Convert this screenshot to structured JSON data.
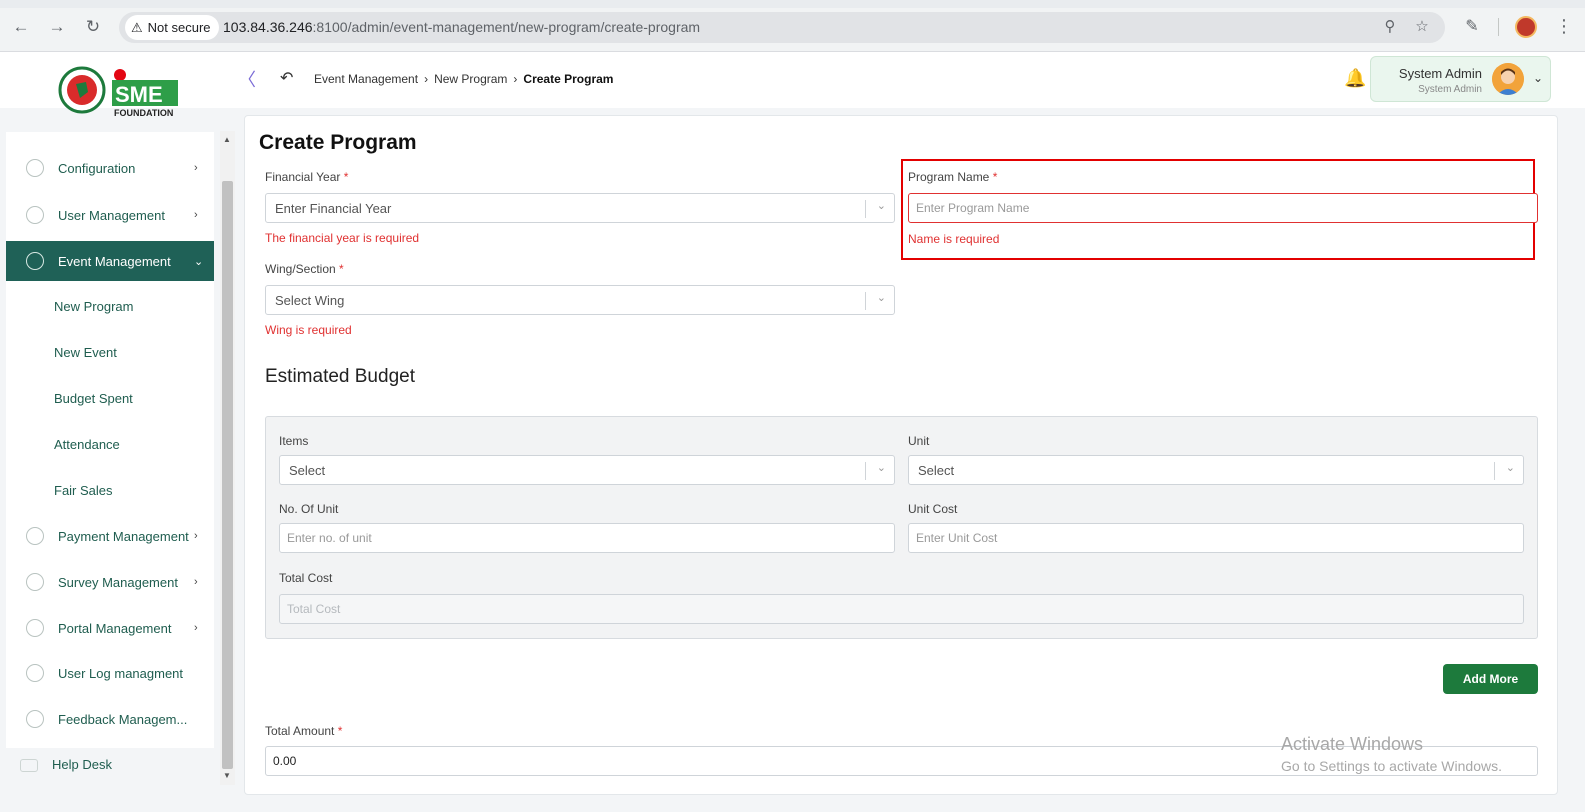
{
  "browser": {
    "security_label": "Not secure",
    "url_host": "103.84.36.246",
    "url_rest": ":8100/admin/event-management/new-program/create-program",
    "icons": {
      "back": "arrow-left-icon",
      "forward": "arrow-right-icon",
      "reload": "reload-icon",
      "zoom": "zoom-icon",
      "bookmark": "star-icon",
      "extensions": "puzzle-icon",
      "menu": "kebab-icon"
    }
  },
  "header": {
    "logo_text": "SME",
    "logo_sub": "FOUNDATION",
    "breadcrumb": [
      "Event Management",
      "New Program",
      "Create Program"
    ],
    "user_name": "System Admin",
    "user_role": "System Admin"
  },
  "sidebar": {
    "items": [
      {
        "label": "Configuration",
        "icon": "config-icon"
      },
      {
        "label": "User Management",
        "icon": "user-shield-icon"
      },
      {
        "label": "Event Management",
        "icon": "event-icon"
      },
      {
        "label": "Payment Management",
        "icon": "payment-icon"
      },
      {
        "label": "Survey Management",
        "icon": "survey-icon"
      },
      {
        "label": "Portal Management",
        "icon": "portal-icon"
      },
      {
        "label": "User Log managment",
        "icon": "log-icon"
      },
      {
        "label": "Feedback Managem...",
        "icon": "feedback-icon"
      }
    ],
    "sub_items": [
      "New Program",
      "New Event",
      "Budget Spent",
      "Attendance",
      "Fair Sales"
    ],
    "help_desk": "Help Desk"
  },
  "form": {
    "title": "Create Program",
    "financial_year": {
      "label": "Financial Year",
      "placeholder": "Enter Financial Year",
      "error": "The financial year is required"
    },
    "program_name": {
      "label": "Program Name",
      "placeholder": "Enter Program Name",
      "error": "Name is required"
    },
    "wing": {
      "label": "Wing/Section",
      "placeholder": "Select Wing",
      "error": "Wing is required"
    },
    "required_mark": "*",
    "budget": {
      "title": "Estimated Budget",
      "items_label": "Items",
      "items_placeholder": "Select",
      "unit_label": "Unit",
      "unit_placeholder": "Select",
      "no_of_unit_label": "No. Of Unit",
      "no_of_unit_placeholder": "Enter no. of unit",
      "unit_cost_label": "Unit Cost",
      "unit_cost_placeholder": "Enter Unit Cost",
      "total_cost_label": "Total Cost",
      "total_cost_placeholder": "Total Cost"
    },
    "add_more": "Add More",
    "total_amount": {
      "label": "Total Amount",
      "value": "0.00"
    }
  },
  "watermark": {
    "line1": "Activate Windows",
    "line2": "Go to Settings to activate Windows."
  },
  "colors": {
    "primary": "#1f6157",
    "button": "#1d7a3c",
    "error": "#e03131",
    "highlight": "#e30000"
  }
}
